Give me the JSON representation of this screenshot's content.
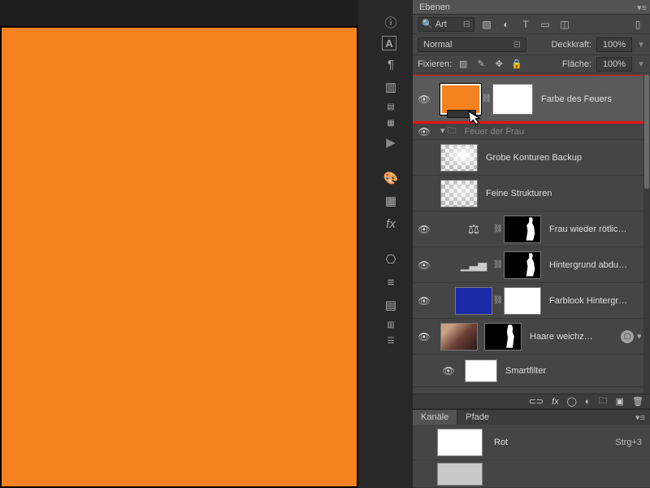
{
  "canvas": {
    "bg": "#f6821f"
  },
  "panel": {
    "title": "Ebenen",
    "search_kind": "Art",
    "blend_mode": "Normal",
    "opacity_label": "Deckkraft:",
    "opacity_value": "100%",
    "lock_label": "Fixieren:",
    "fill_label": "Fläche:",
    "fill_value": "100%"
  },
  "layers": [
    {
      "name": "Farbe des Feuers",
      "visible": true
    },
    {
      "name": "Feuer der Frau",
      "visible": true
    },
    {
      "name": "Grobe Konturen Backup",
      "visible": false
    },
    {
      "name": "Feine Strukturen",
      "visible": false
    },
    {
      "name": "Frau wieder rötlic…",
      "visible": true
    },
    {
      "name": "Hintergrund abdu…",
      "visible": true
    },
    {
      "name": "Farblook Hintergr…",
      "visible": true
    },
    {
      "name": "Haare weichz…",
      "visible": true
    },
    {
      "name": "Smartfilter",
      "visible": true
    }
  ],
  "channels": {
    "tab1": "Kanäle",
    "tab2": "Pfade",
    "row1": {
      "name": "Rot",
      "shortcut": "Strg+3"
    }
  }
}
